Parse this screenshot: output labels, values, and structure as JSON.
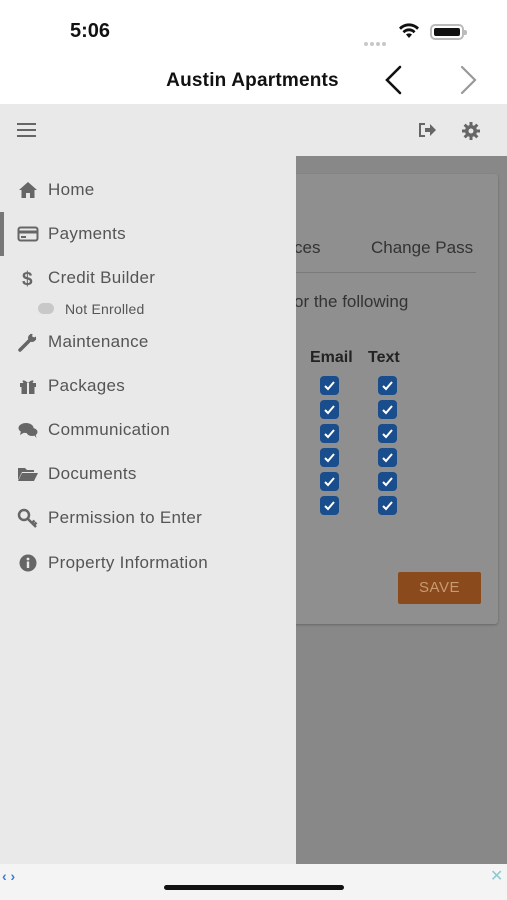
{
  "status_bar": {
    "time": "5:06"
  },
  "nav": {
    "title": "Austin Apartments"
  },
  "drawer": {
    "items": [
      {
        "label": "Home",
        "icon": "home-icon"
      },
      {
        "label": "Payments",
        "icon": "credit-card-icon",
        "active": true
      },
      {
        "label": "Credit Builder",
        "icon": "dollar-icon"
      },
      {
        "label": "Maintenance",
        "icon": "wrench-icon"
      },
      {
        "label": "Packages",
        "icon": "gift-icon"
      },
      {
        "label": "Communication",
        "icon": "chat-bubbles-icon"
      },
      {
        "label": "Documents",
        "icon": "folder-open-icon"
      },
      {
        "label": "Permission to Enter",
        "icon": "key-icon"
      },
      {
        "label": "Property Information",
        "icon": "info-circle-icon"
      }
    ],
    "credit_builder_status": "Not Enrolled"
  },
  "background": {
    "tabs": [
      "ces",
      "Change Pass"
    ],
    "intro_text": "or the following",
    "columns": [
      "Email",
      "Text"
    ],
    "rows": [
      {
        "email": true,
        "text": true
      },
      {
        "email": true,
        "text": true
      },
      {
        "email": true,
        "text": true
      },
      {
        "email": true,
        "text": true
      },
      {
        "email": true,
        "text": true
      },
      {
        "email": true,
        "text": true
      }
    ],
    "save_label": "SAVE"
  },
  "colors": {
    "checkbox": "#1a4d8c",
    "save_button": "#8a4a1c",
    "drawer_bg": "#e9e9e9",
    "overlay": "#888888"
  }
}
